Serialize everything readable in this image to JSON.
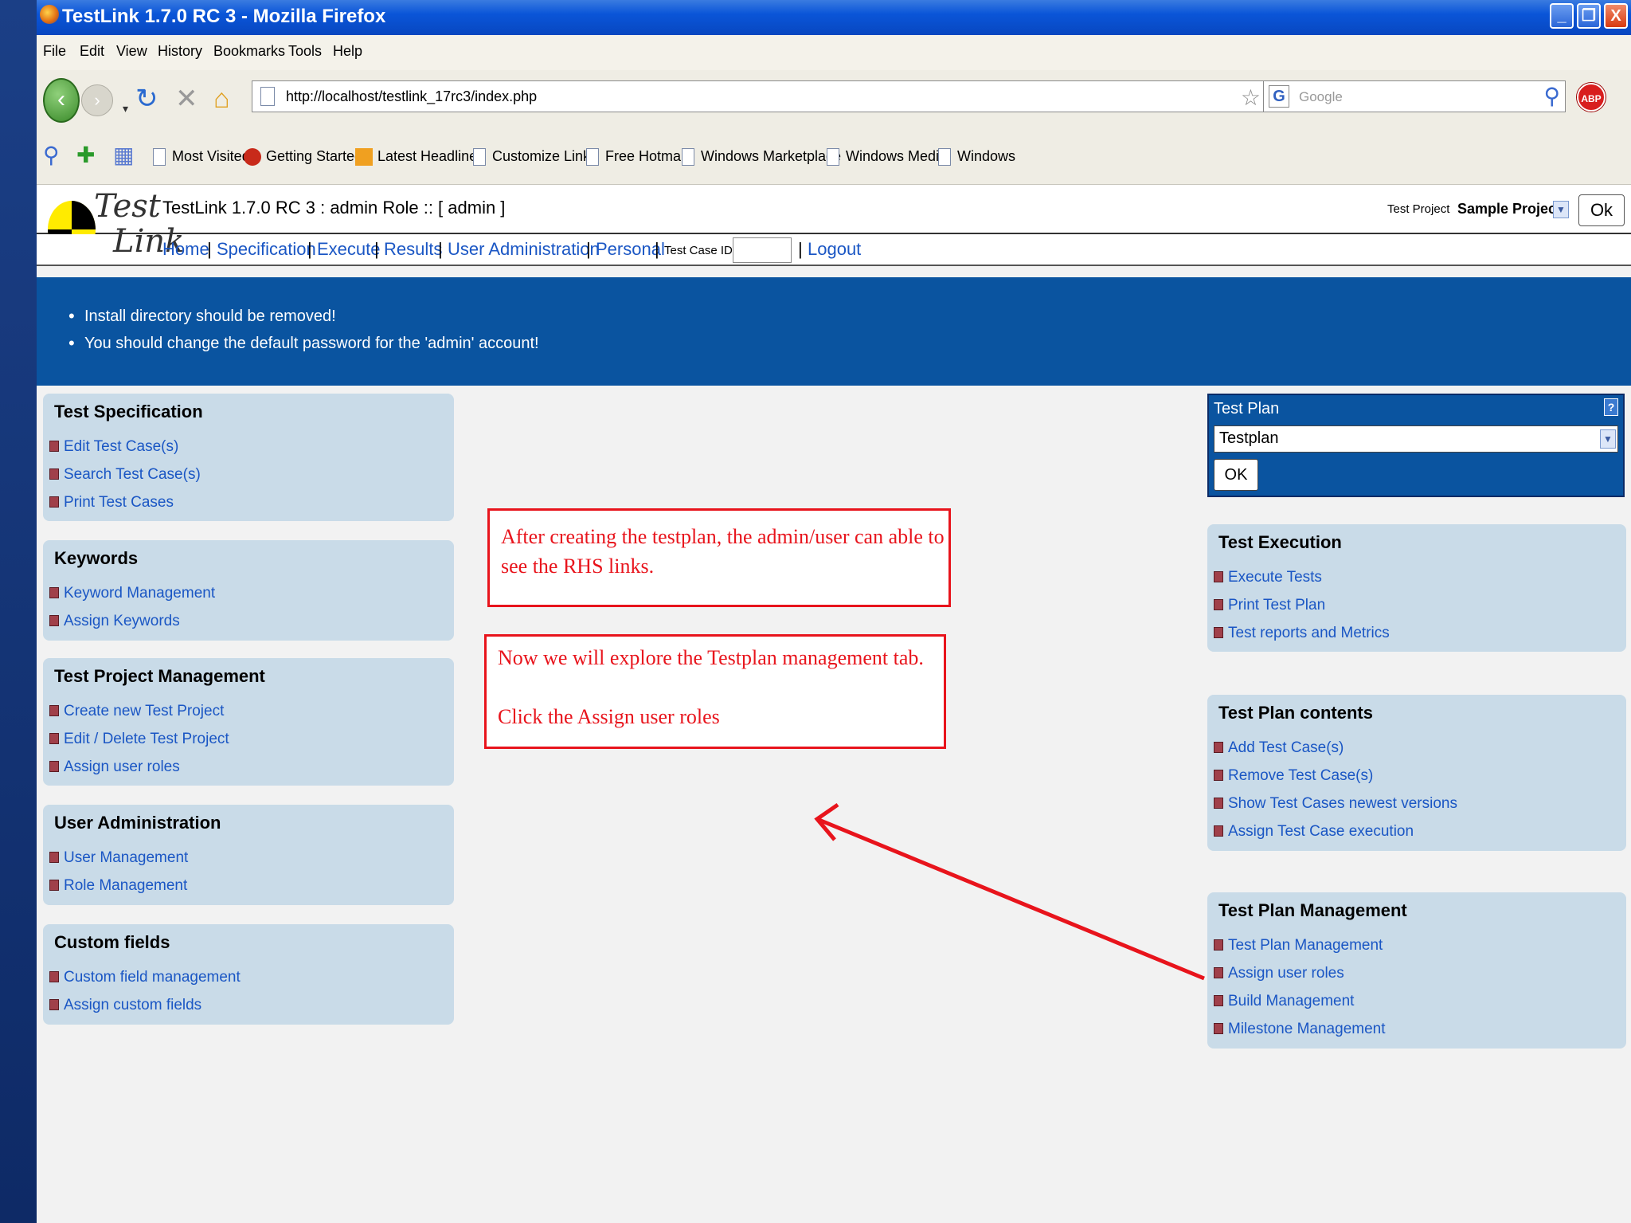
{
  "window": {
    "title": "TestLink 1.7.0 RC 3 - Mozilla Firefox",
    "buttons": [
      "_",
      "❐",
      "X"
    ]
  },
  "menu": [
    "File",
    "Edit",
    "View",
    "History",
    "Bookmarks",
    "Tools",
    "Help"
  ],
  "navbar": {
    "url": "http://localhost/testlink_17rc3/index.php",
    "search_placeholder": "Google",
    "abp": "ABP"
  },
  "bookmarks": [
    "Most Visited",
    "Getting Started",
    "Latest Headlines",
    "Customize Links",
    "Free Hotmail",
    "Windows Marketplace",
    "Windows Media",
    "Windows"
  ],
  "testlink": {
    "logo_top": "Test",
    "logo_bottom": "Link",
    "title": "TestLink 1.7.0 RC 3 : admin Role :: [ admin ]",
    "project_label": "Test Project",
    "project_name": "Sample Project",
    "ok": "Ok",
    "nav": [
      "Home",
      "Specification",
      "Execute",
      "Results",
      "User Administration",
      "Personal"
    ],
    "test_case_id_label": "Test Case ID:",
    "logout": "Logout",
    "warnings": [
      "Install directory should be removed!",
      "You should change the default password for the 'admin' account!"
    ]
  },
  "left_panels": [
    {
      "title": "Test Specification",
      "links": [
        "Edit Test Case(s)",
        "Search Test Case(s)",
        "Print Test Cases"
      ]
    },
    {
      "title": "Keywords",
      "links": [
        "Keyword Management",
        "Assign Keywords"
      ]
    },
    {
      "title": "Test Project Management",
      "links": [
        "Create new Test Project",
        "Edit / Delete Test Project",
        "Assign user roles"
      ]
    },
    {
      "title": "User Administration",
      "links": [
        "User Management",
        "Role Management"
      ]
    },
    {
      "title": "Custom fields",
      "links": [
        "Custom field management",
        "Assign custom fields"
      ]
    }
  ],
  "test_plan_box": {
    "label": "Test Plan",
    "help": "?",
    "selected": "Testplan",
    "ok": "OK"
  },
  "right_panels": [
    {
      "title": "Test Execution",
      "links": [
        "Execute Tests",
        "Print Test Plan",
        "Test reports and Metrics"
      ]
    },
    {
      "title": "Test Plan contents",
      "links": [
        "Add Test Case(s)",
        "Remove Test Case(s)",
        "Show Test Cases newest versions",
        "Assign Test Case execution"
      ]
    },
    {
      "title": "Test Plan Management",
      "links": [
        "Test Plan Management",
        "Assign user roles",
        "Build Management",
        "Milestone Management"
      ]
    }
  ],
  "notes": {
    "note1_line1": "After creating the testplan, the admin/user can able to",
    "note1_line2": "see the RHS links.",
    "note2_line1": "Now we will explore the Testplan management tab.",
    "note2_line2": "Click the Assign user roles"
  },
  "colors": {
    "accent_blue": "#0a54a0",
    "link": "#1a56c4",
    "annotation_red": "#e8141c",
    "panel": "#c9dbe8"
  }
}
